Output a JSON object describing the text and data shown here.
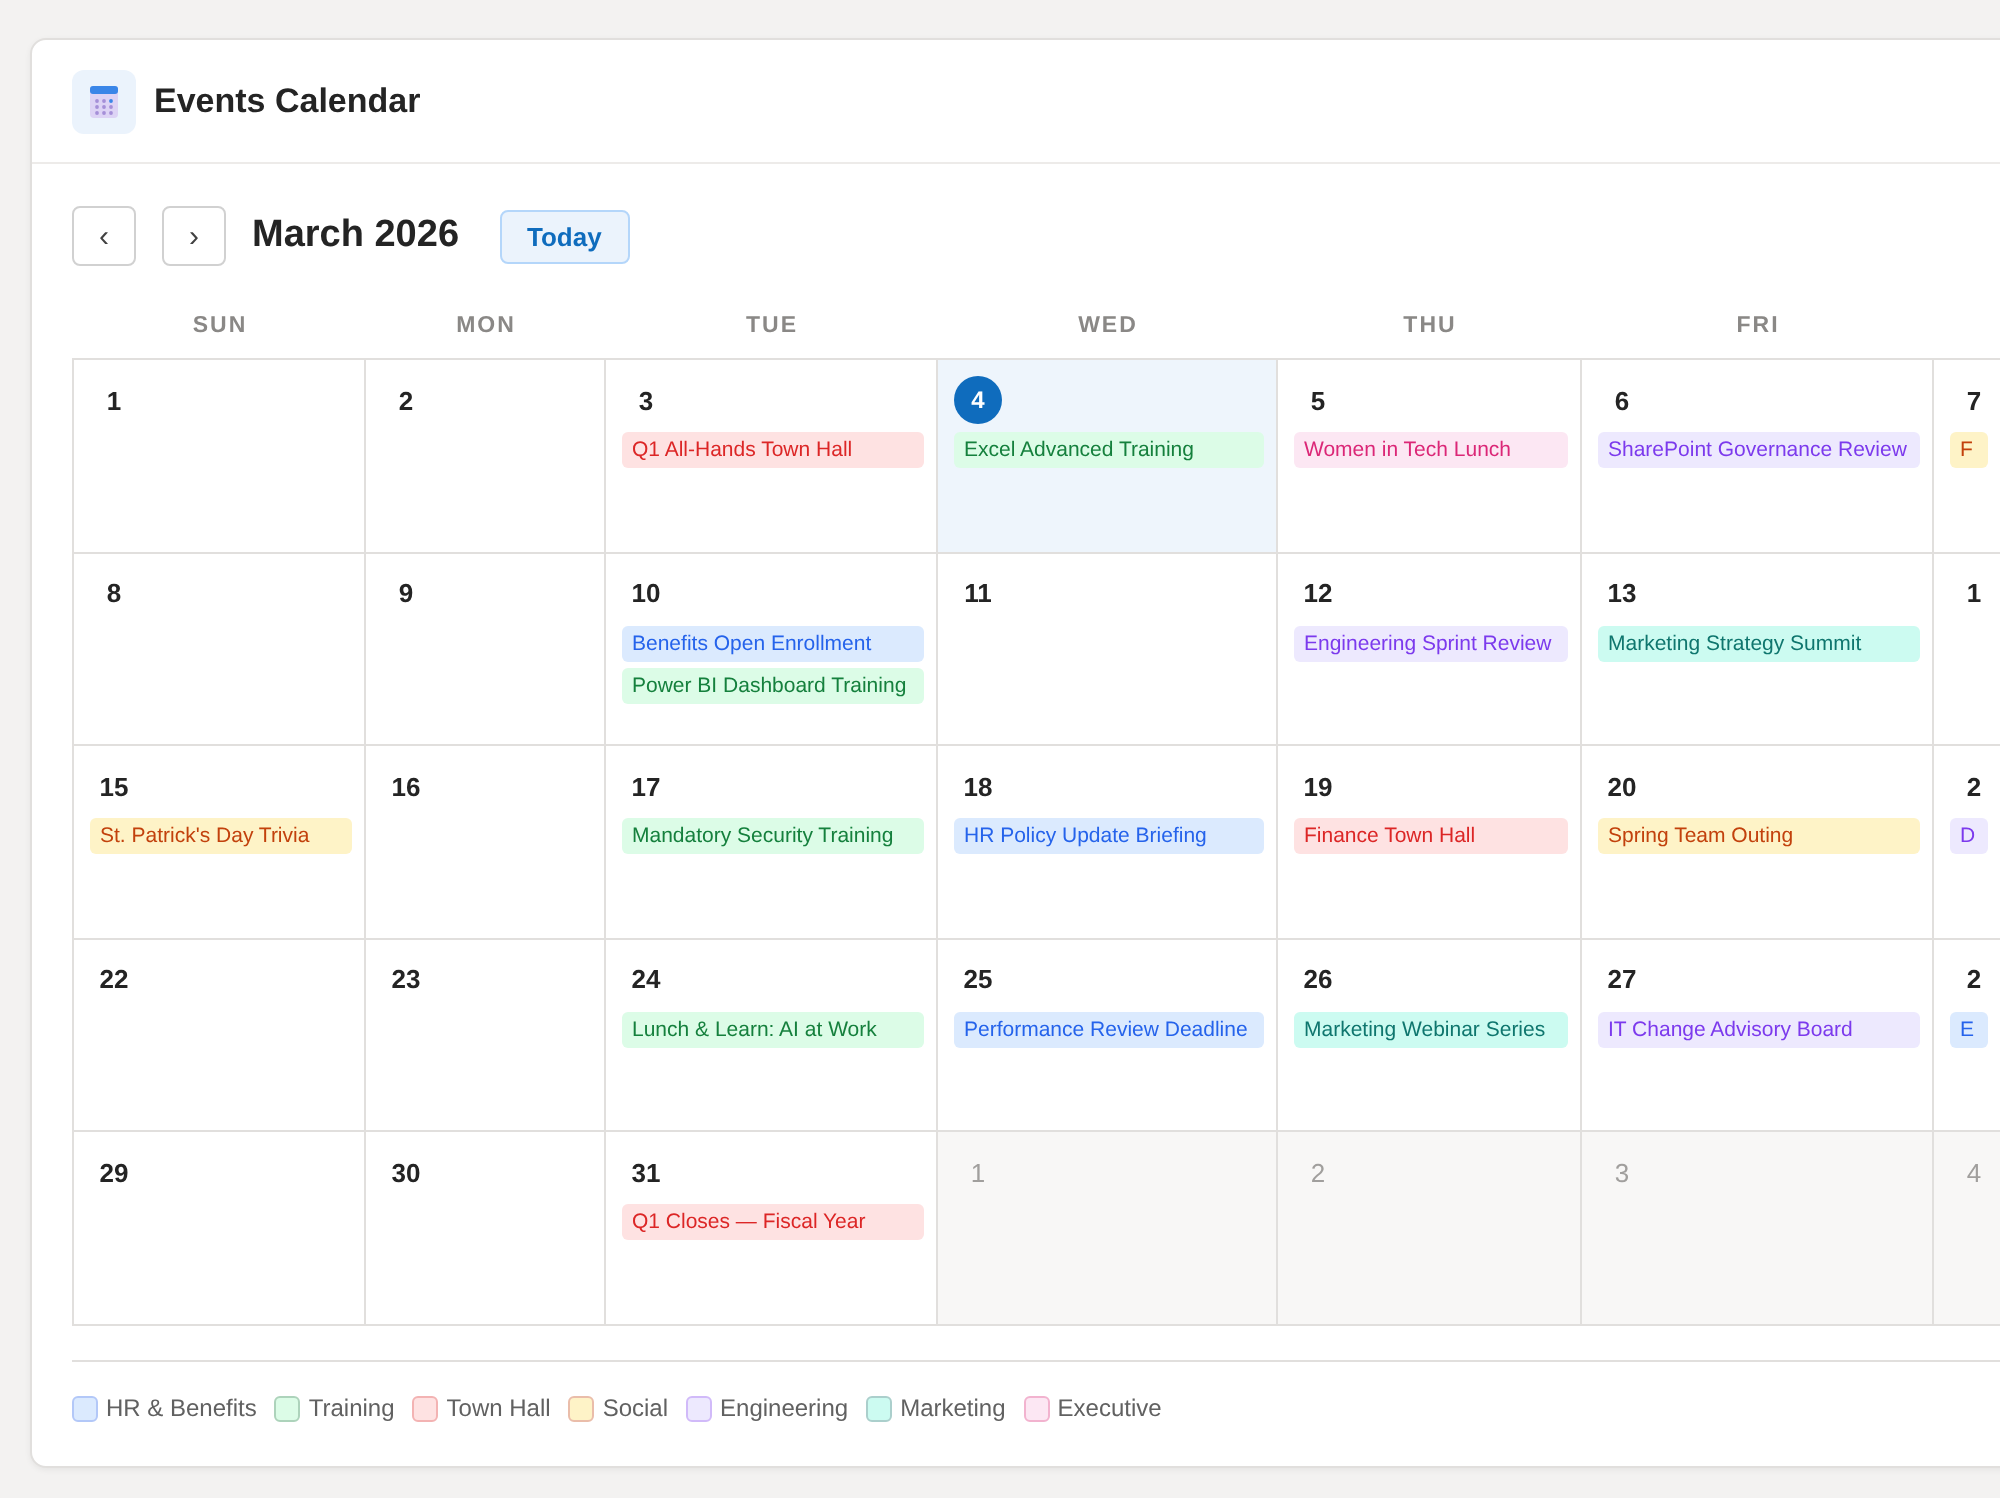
{
  "window": {
    "title": "Events Calendar"
  },
  "toolbar": {
    "prev": "‹",
    "next": "›",
    "month": "March 2026",
    "today_button": "Today"
  },
  "weekdays": [
    "SUN",
    "MON",
    "TUE",
    "WED",
    "THU",
    "FRI"
  ],
  "weeks": [
    {
      "days": [
        {
          "date": "1",
          "today": false,
          "other_month": false
        },
        {
          "date": "2",
          "today": false,
          "other_month": false
        },
        {
          "date": "3",
          "today": false,
          "other_month": false,
          "events": [
            {
              "title": "Q1 All-Hands Town Hall",
              "color": "#fee2e2"
            }
          ]
        },
        {
          "date": "4",
          "today": true,
          "other_month": false,
          "events": [
            {
              "title": "Excel Advanced Training",
              "color": "#dcfce7"
            }
          ]
        },
        {
          "date": "5",
          "today": false,
          "other_month": false,
          "events": [
            {
              "title": "Women in Tech Lunch",
              "color": "#fce7f3"
            }
          ]
        },
        {
          "date": "6",
          "today": false,
          "other_month": false,
          "events": [
            {
              "title": "SharePoint Governance Review",
              "color": "#ede9fe"
            }
          ]
        },
        {
          "date": "7",
          "today": false,
          "other_month": false,
          "events": [
            {
              "title": "F",
              "color": "#fef3c7"
            }
          ]
        }
      ]
    },
    {
      "days": [
        {
          "date": "8",
          "today": false,
          "other_month": false
        },
        {
          "date": "9",
          "today": false,
          "other_month": false
        },
        {
          "date": "10",
          "today": false,
          "other_month": false,
          "events": [
            {
              "title": "Benefits Open Enrollment",
              "color": "#dbeafe"
            },
            {
              "title": "Power BI Dashboard Training",
              "color": "#dcfce7"
            }
          ]
        },
        {
          "date": "11",
          "today": false,
          "other_month": false
        },
        {
          "date": "12",
          "today": false,
          "other_month": false,
          "events": [
            {
              "title": "Engineering Sprint Review",
              "color": "#ede9fe"
            }
          ]
        },
        {
          "date": "13",
          "today": false,
          "other_month": false,
          "events": [
            {
              "title": "Marketing Strategy Summit",
              "color": "#ccfbf1"
            }
          ]
        },
        {
          "date": "1",
          "today": false,
          "other_month": false
        }
      ]
    },
    {
      "days": [
        {
          "date": "15",
          "today": false,
          "other_month": false,
          "events": [
            {
              "title": "St. Patrick's Day Trivia",
              "color": "#fef3c7"
            }
          ]
        },
        {
          "date": "16",
          "today": false,
          "other_month": false
        },
        {
          "date": "17",
          "today": false,
          "other_month": false,
          "events": [
            {
              "title": "Mandatory Security Training",
              "color": "#dcfce7"
            }
          ]
        },
        {
          "date": "18",
          "today": false,
          "other_month": false,
          "events": [
            {
              "title": "HR Policy Update Briefing",
              "color": "#dbeafe"
            }
          ]
        },
        {
          "date": "19",
          "today": false,
          "other_month": false,
          "events": [
            {
              "title": "Finance Town Hall",
              "color": "#fee2e2"
            }
          ]
        },
        {
          "date": "20",
          "today": false,
          "other_month": false,
          "events": [
            {
              "title": "Spring Team Outing",
              "color": "#fef3c7"
            }
          ]
        },
        {
          "date": "2",
          "today": false,
          "other_month": false,
          "events": [
            {
              "title": "D",
              "color": "#ede9fe"
            }
          ]
        }
      ]
    },
    {
      "days": [
        {
          "date": "22",
          "today": false,
          "other_month": false
        },
        {
          "date": "23",
          "today": false,
          "other_month": false
        },
        {
          "date": "24",
          "today": false,
          "other_month": false,
          "events": [
            {
              "title": "Lunch & Learn: AI at Work",
              "color": "#dcfce7"
            }
          ]
        },
        {
          "date": "25",
          "today": false,
          "other_month": false,
          "events": [
            {
              "title": "Performance Review Deadline",
              "color": "#dbeafe"
            }
          ]
        },
        {
          "date": "26",
          "today": false,
          "other_month": false,
          "events": [
            {
              "title": "Marketing Webinar Series",
              "color": "#ccfbf1"
            }
          ]
        },
        {
          "date": "27",
          "today": false,
          "other_month": false,
          "events": [
            {
              "title": "IT Change Advisory Board",
              "color": "#ede9fe"
            }
          ]
        },
        {
          "date": "2",
          "today": false,
          "other_month": false,
          "events": [
            {
              "title": "E",
              "color": "#dbeafe"
            }
          ]
        }
      ]
    },
    {
      "days": [
        {
          "date": "29",
          "today": false,
          "other_month": false
        },
        {
          "date": "30",
          "today": false,
          "other_month": false
        },
        {
          "date": "31",
          "today": false,
          "other_month": false,
          "events": [
            {
              "title": "Q1 Closes — Fiscal Year",
              "color": "#fee2e2"
            }
          ]
        },
        {
          "date": "1",
          "today": false,
          "other_month": true
        },
        {
          "date": "2",
          "today": false,
          "other_month": true
        },
        {
          "date": "3",
          "today": false,
          "other_month": true
        },
        {
          "date": "4",
          "today": false,
          "other_month": true
        }
      ]
    }
  ],
  "legend": [
    {
      "label": "HR & Benefits",
      "color": "#dbeafe"
    },
    {
      "label": "Training",
      "color": "#dcfce7"
    },
    {
      "label": "Town Hall",
      "color": "#fee2e2"
    },
    {
      "label": "Social",
      "color": "#fef3c7"
    },
    {
      "label": "Engineering",
      "color": "#ede9fe"
    },
    {
      "label": "Marketing",
      "color": "#ccfbf1"
    },
    {
      "label": "Executive",
      "color": "#fce7f3"
    }
  ]
}
